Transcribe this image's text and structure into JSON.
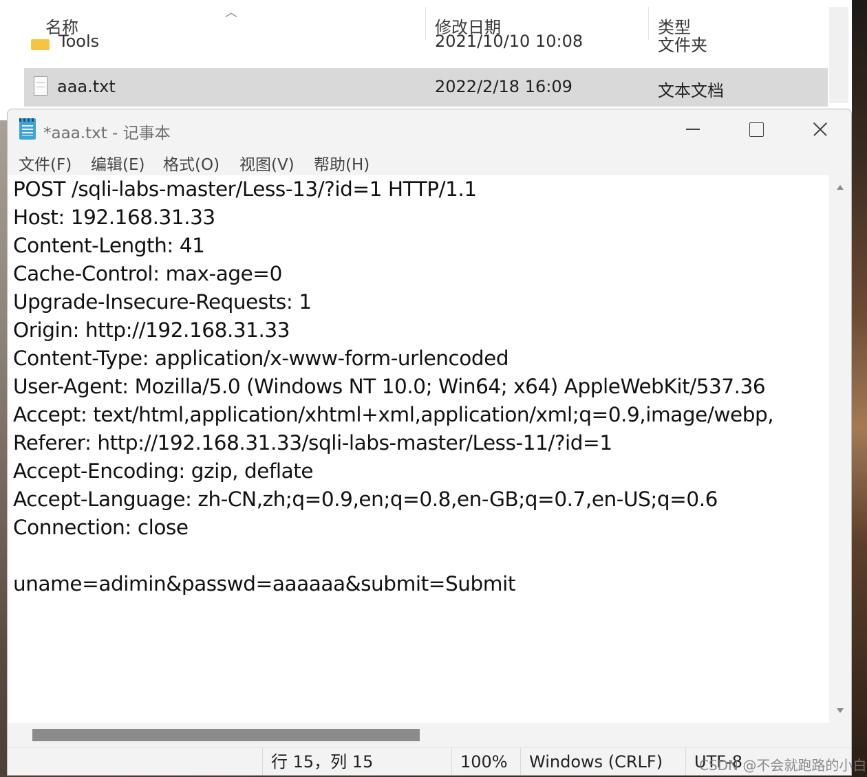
{
  "explorer": {
    "columns": {
      "name": "名称",
      "modified": "修改日期",
      "type": "类型"
    },
    "rows": [
      {
        "name": "Tools",
        "modified": "2021/10/10 10:08",
        "type": "文件夹"
      },
      {
        "name": "aaa.txt",
        "modified": "2022/2/18 16:09",
        "type": "文本文档"
      }
    ]
  },
  "notepad": {
    "title": "*aaa.txt - 记事本",
    "menu": [
      "文件(F)",
      "编辑(E)",
      "格式(O)",
      "视图(V)",
      "帮助(H)"
    ],
    "lines": [
      "POST /sqli-labs-master/Less-13/?id=1 HTTP/1.1",
      "Host: 192.168.31.33",
      "Content-Length: 41",
      "Cache-Control: max-age=0",
      "Upgrade-Insecure-Requests: 1",
      "Origin: http://192.168.31.33",
      "Content-Type: application/x-www-form-urlencoded",
      "User-Agent: Mozilla/5.0 (Windows NT 10.0; Win64; x64) AppleWebKit/537.36",
      "Accept: text/html,application/xhtml+xml,application/xml;q=0.9,image/webp,",
      "Referer: http://192.168.31.33/sqli-labs-master/Less-11/?id=1",
      "Accept-Encoding: gzip, deflate",
      "Accept-Language: zh-CN,zh;q=0.9,en;q=0.8,en-GB;q=0.7,en-US;q=0.6",
      "Connection: close",
      "",
      "uname=adimin&passwd=aaaaaa&submit=Submit"
    ],
    "status": {
      "position": "行 15，列 15",
      "zoom": "100%",
      "line_ending": "Windows (CRLF)",
      "encoding": "UTF-8"
    }
  },
  "watermark": "CSDN @不会就跑路的小白"
}
